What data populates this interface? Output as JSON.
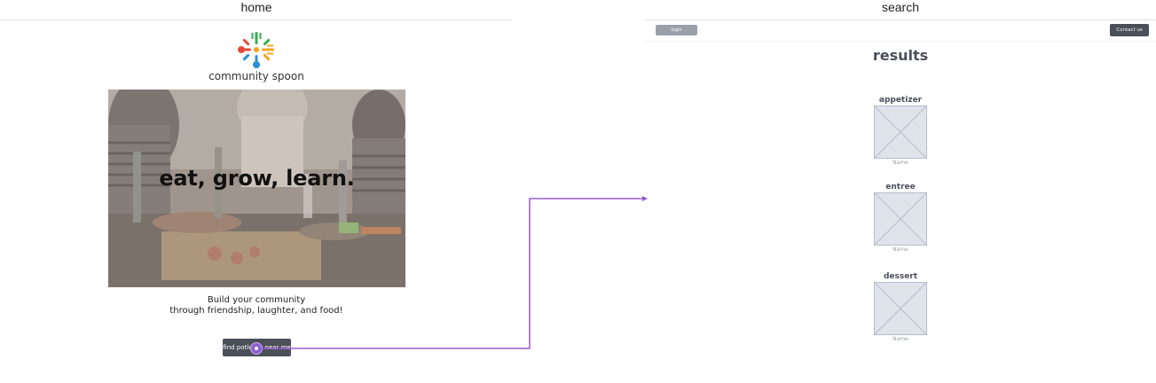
{
  "frames": {
    "home": {
      "title": "home",
      "brand": "community spoon",
      "hero_heading": "eat, grow, learn.",
      "tagline_line1": "Build your community",
      "tagline_line2": "through friendship, laughter, and food!",
      "cta_label": "find potlucks near me"
    },
    "search": {
      "title": "search",
      "login_label": "login",
      "contact_label": "Contact us",
      "results_title": "results",
      "categories": [
        {
          "label": "appetizer",
          "name": "Name"
        },
        {
          "label": "entree",
          "name": "Name"
        },
        {
          "label": "dessert",
          "name": "Name"
        }
      ]
    }
  },
  "colors": {
    "accent": "#9b59d0",
    "button_dark": "#4a4f58",
    "button_light": "#9aa0aa",
    "placeholder_fill": "#dfe3ea",
    "placeholder_line": "#b7bdc8"
  },
  "icons": [
    "spoon-fork-logo-icon",
    "image-placeholder-icon"
  ]
}
